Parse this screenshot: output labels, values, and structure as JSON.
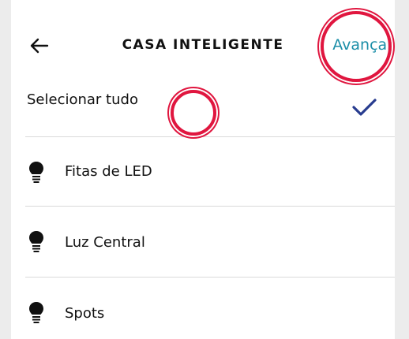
{
  "header": {
    "back_icon": "arrow-left-icon",
    "title": "CASA INTELIGENTE",
    "next_label": "Avançar",
    "next_color": "#1b8ea8"
  },
  "select_all": {
    "label": "Selecionar tudo",
    "checked": true,
    "check_icon": "checkmark-icon",
    "check_color": "#283c8f"
  },
  "devices": [
    {
      "label": "Fitas de LED",
      "icon": "lightbulb-icon"
    },
    {
      "label": "Luz Central",
      "icon": "lightbulb-icon"
    },
    {
      "label": "Spots",
      "icon": "lightbulb-icon"
    }
  ],
  "annotation_color": "#e0163f"
}
